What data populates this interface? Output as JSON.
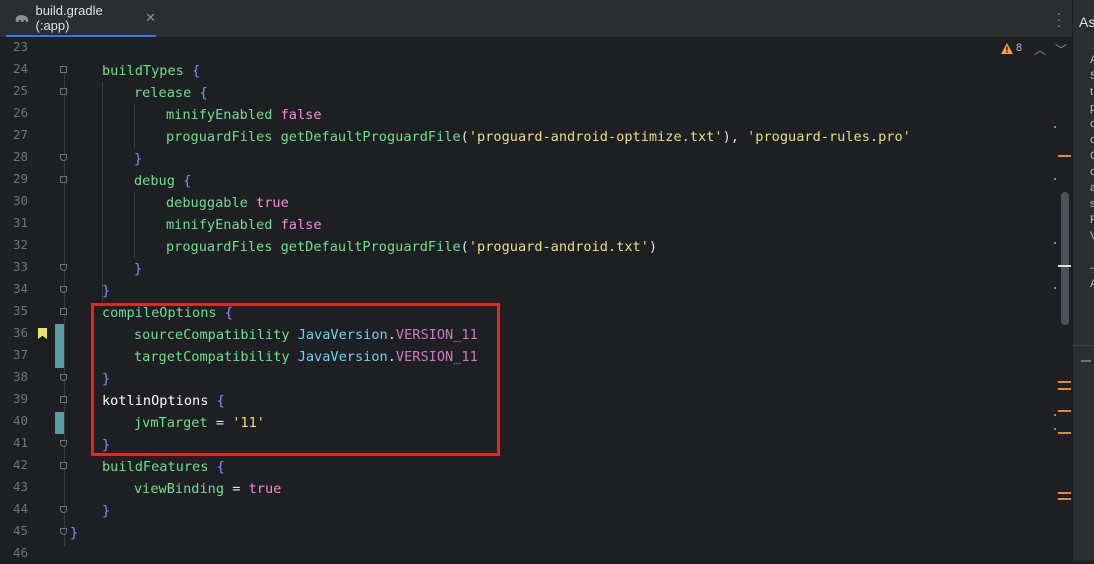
{
  "tab": {
    "title": "build.gradle (:app)",
    "close": "✕"
  },
  "toolbar": {
    "warning_count": "8",
    "nav_up": "⌃",
    "nav_down": "⌄",
    "menu": "⋮"
  },
  "right_panel": {
    "title": "As",
    "letters": [
      "A",
      "S",
      "t",
      "p",
      "o",
      "o",
      "C",
      "o",
      "a",
      "s",
      "F",
      "V",
      "",
      "—",
      "A"
    ]
  },
  "line_numbers": [
    "23",
    "24",
    "25",
    "26",
    "27",
    "28",
    "29",
    "30",
    "31",
    "32",
    "33",
    "34",
    "35",
    "36",
    "37",
    "38",
    "39",
    "40",
    "41",
    "42",
    "43",
    "44",
    "45",
    "46"
  ],
  "code": {
    "l24": {
      "k": "buildTypes",
      "b": "{"
    },
    "l25": {
      "k": "release",
      "b": "{"
    },
    "l26": {
      "k": "minifyEnabled",
      "v": "false"
    },
    "l27": {
      "k": "proguardFiles",
      "f": "getDefaultProguardFile",
      "open": "(",
      "s1": "'proguard-android-optimize.txt'",
      "close": ")",
      "comma": ", ",
      "s2": "'proguard-rules.pro'"
    },
    "l28": {
      "b": "}"
    },
    "l29": {
      "k": "debug",
      "b": "{"
    },
    "l30": {
      "k": "debuggable",
      "v": "true"
    },
    "l31": {
      "k": "minifyEnabled",
      "v": "false"
    },
    "l32": {
      "k": "proguardFiles",
      "f": "getDefaultProguardFile",
      "open": "(",
      "s1": "'proguard-android.txt'",
      "close": ")"
    },
    "l33": {
      "b": "}"
    },
    "l34": {
      "b": "}"
    },
    "l35": {
      "k": "compileOptions",
      "b": "{"
    },
    "l36": {
      "k": "sourceCompatibility",
      "cls": "JavaVersion",
      "dot": ".",
      "c": "VERSION_11"
    },
    "l37": {
      "k": "targetCompatibility",
      "cls": "JavaVersion",
      "dot": ".",
      "c": "VERSION_11"
    },
    "l38": {
      "b": "}"
    },
    "l39": {
      "k": "kotlinOptions",
      "b": "{"
    },
    "l40": {
      "k": "jvmTarget",
      "eq": " = ",
      "s": "'11'"
    },
    "l41": {
      "b": "}"
    },
    "l42": {
      "k": "buildFeatures",
      "b": "{"
    },
    "l43": {
      "k": "viewBinding",
      "eq": " = ",
      "v": "true"
    },
    "l44": {
      "b": "}"
    },
    "l45": {
      "b": "}"
    }
  },
  "colors": {
    "keyword": "#6ce08e",
    "brace": "#8b8dfa",
    "boolean": "#f98bd9",
    "string": "#ecdf7a",
    "class": "#6bd3f8",
    "constant": "#c77dbb",
    "highlight": "#e8251f",
    "accent": "#3574f0"
  }
}
